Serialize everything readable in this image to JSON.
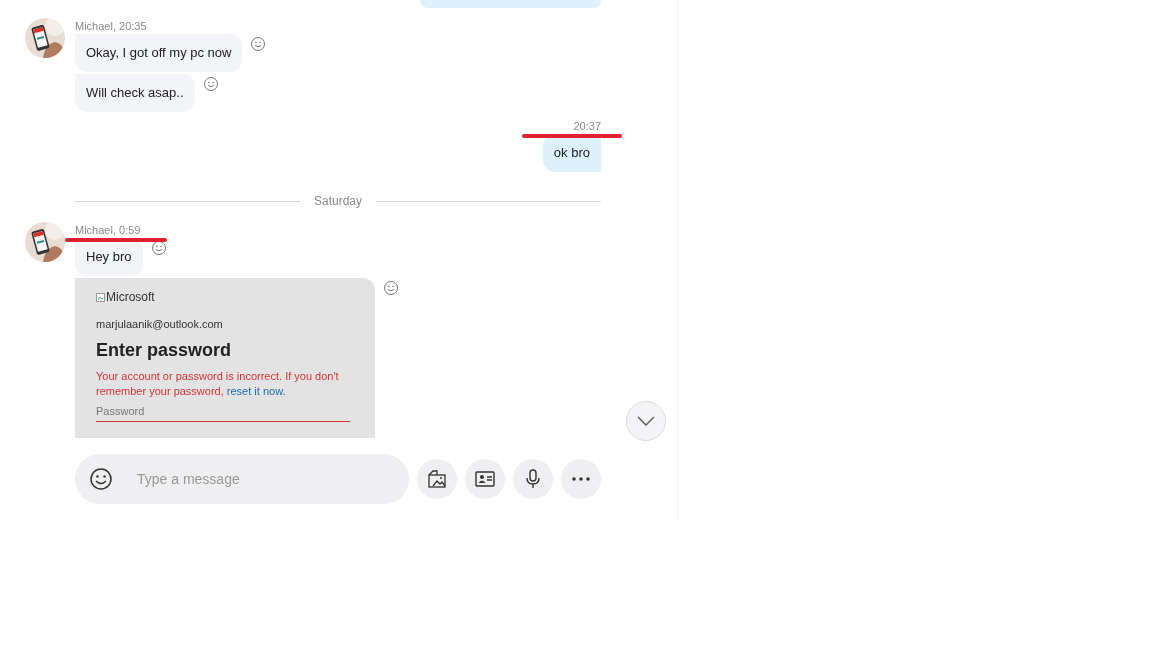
{
  "messages": [
    {
      "kind": "fragment",
      "outgoing": true
    },
    {
      "kind": "group",
      "outgoing": false,
      "sender_meta": "Michael, 20:35",
      "highlighted": false,
      "bubbles": [
        {
          "kind": "text",
          "text": "Okay, I got off my pc now"
        },
        {
          "kind": "text",
          "text": "Will check asap.."
        }
      ]
    },
    {
      "kind": "group",
      "outgoing": true,
      "sender_meta": "20:37",
      "highlighted": true,
      "bubbles": [
        {
          "kind": "text",
          "text": "ok bro"
        }
      ]
    },
    {
      "kind": "divider",
      "text": "Saturday"
    },
    {
      "kind": "group",
      "outgoing": false,
      "sender_meta": "Michael, 0:59",
      "highlighted": true,
      "bubbles": [
        {
          "kind": "text",
          "text": "Hey bro"
        },
        {
          "kind": "screenshot",
          "logo_alt": "Microsoft",
          "email": "marjulaanik@outlook.com",
          "heading": "Enter password",
          "error": "Your account or password is incorrect. If you don't remember your password,",
          "link": "reset it now.",
          "field_placeholder": "Password"
        }
      ]
    }
  ],
  "composer": {
    "placeholder": "Type a message"
  }
}
